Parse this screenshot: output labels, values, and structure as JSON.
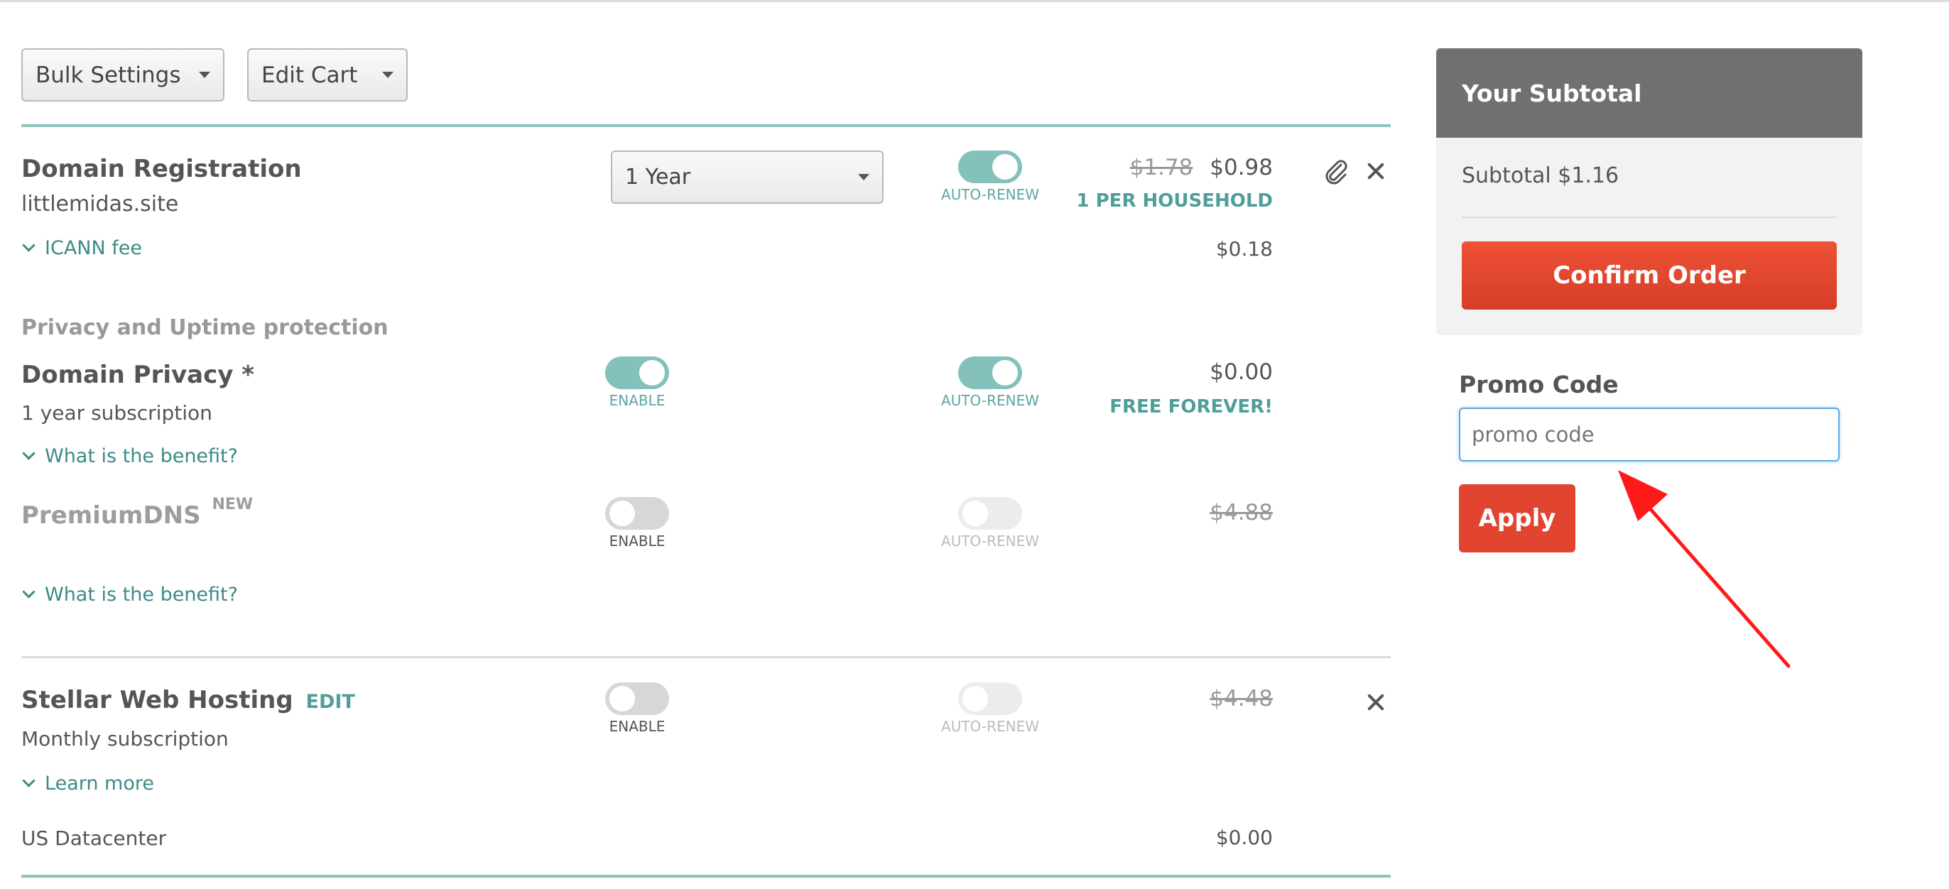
{
  "toolbar": {
    "bulk_settings": "Bulk Settings",
    "edit_cart": "Edit Cart"
  },
  "domain": {
    "title": "Domain Registration",
    "name": "littlemidas.site",
    "period": "1 Year",
    "auto_renew_label": "AUTO-RENEW",
    "auto_renew_on": true,
    "old_price": "$1.78",
    "price": "$0.98",
    "note": "1 PER HOUSEHOLD",
    "fee_label": "ICANN fee",
    "fee_price": "$0.18"
  },
  "privacy_section_label": "Privacy and Uptime protection",
  "privacy": {
    "title": "Domain Privacy *",
    "subtitle": "1 year subscription",
    "enable_label": "ENABLE",
    "enabled": true,
    "auto_renew_label": "AUTO-RENEW",
    "auto_renew_on": true,
    "price": "$0.00",
    "note": "FREE FOREVER!",
    "benefit_link": "What is the benefit?"
  },
  "premium_dns": {
    "title": "PremiumDNS",
    "badge": "NEW",
    "enable_label": "ENABLE",
    "enabled": false,
    "auto_renew_label": "AUTO-RENEW",
    "auto_renew_on": false,
    "price": "$4.88",
    "benefit_link": "What is the benefit?"
  },
  "hosting": {
    "title": "Stellar Web Hosting",
    "edit_label": "EDIT",
    "subtitle": "Monthly subscription",
    "enable_label": "ENABLE",
    "enabled": false,
    "auto_renew_label": "AUTO-RENEW",
    "auto_renew_on": false,
    "price": "$4.48",
    "learn_more": "Learn more",
    "datacenter_label": "US Datacenter",
    "datacenter_price": "$0.00"
  },
  "summary": {
    "header": "Your Subtotal",
    "subtotal": "Subtotal $1.16",
    "confirm_label": "Confirm Order"
  },
  "promo": {
    "label": "Promo Code",
    "placeholder": "promo code",
    "apply_label": "Apply"
  },
  "colors": {
    "accent_teal": "#84c1bd",
    "confirm_red": "#e14530",
    "annotation_red": "#ff1a1a"
  }
}
